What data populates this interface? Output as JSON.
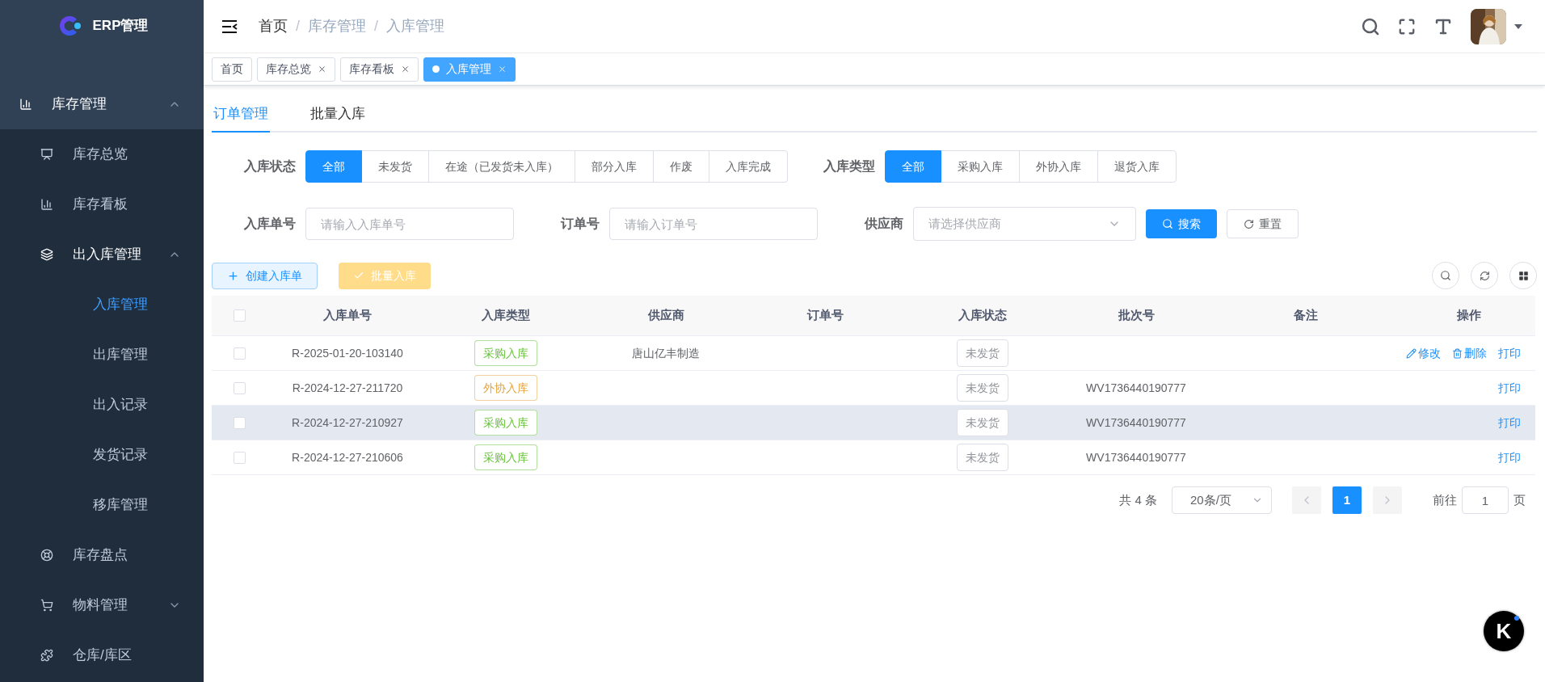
{
  "sidebar": {
    "title": "ERP管理",
    "items": [
      {
        "label": "库存管理",
        "expanded": true,
        "selected": false,
        "children": [
          {
            "label": "库存总览",
            "selected": false
          },
          {
            "label": "库存看板",
            "selected": false
          },
          {
            "label": "出入库管理",
            "expanded": true,
            "selected": false,
            "children": [
              {
                "label": "入库管理",
                "selected": true
              },
              {
                "label": "出库管理",
                "selected": false
              },
              {
                "label": "出入记录",
                "selected": false
              },
              {
                "label": "发货记录",
                "selected": false
              },
              {
                "label": "移库管理",
                "selected": false
              }
            ]
          },
          {
            "label": "库存盘点",
            "selected": false
          },
          {
            "label": "物料管理",
            "expanded": false,
            "selected": false
          },
          {
            "label": "仓库/库区",
            "selected": false
          }
        ]
      }
    ]
  },
  "breadcrumb": [
    "首页",
    "库存管理",
    "入库管理"
  ],
  "breadcrumb_separator": "/",
  "tags": [
    {
      "label": "首页",
      "closable": false,
      "selected": false
    },
    {
      "label": "库存总览",
      "closable": true,
      "selected": false
    },
    {
      "label": "库存看板",
      "closable": true,
      "selected": false
    },
    {
      "label": "入库管理",
      "closable": true,
      "selected": true
    }
  ],
  "tabs": [
    {
      "label": "订单管理",
      "selected": true
    },
    {
      "label": "批量入库",
      "selected": false
    }
  ],
  "filters": [
    {
      "label": "入库状态",
      "options": [
        {
          "label": "全部",
          "selected": true
        },
        {
          "label": "未发货",
          "selected": false
        },
        {
          "label": "在途（已发货未入库）",
          "selected": false
        },
        {
          "label": "部分入库",
          "selected": false
        },
        {
          "label": "作废",
          "selected": false
        },
        {
          "label": "入库完成",
          "selected": false
        }
      ]
    },
    {
      "label": "入库类型",
      "options": [
        {
          "label": "全部",
          "selected": true
        },
        {
          "label": "采购入库",
          "selected": false
        },
        {
          "label": "外协入库",
          "selected": false
        },
        {
          "label": "退货入库",
          "selected": false
        }
      ]
    }
  ],
  "search_fields": [
    {
      "label": "入库单号",
      "placeholder": "请输入入库单号",
      "kind": "input"
    },
    {
      "label": "订单号",
      "placeholder": "请输入订单号",
      "kind": "input"
    },
    {
      "label": "供应商",
      "placeholder": "请选择供应商",
      "kind": "select"
    }
  ],
  "search_button": "搜索",
  "reset_button": "重置",
  "create_button": "创建入库单",
  "batch_button": {
    "label": "批量入库",
    "disabled": true
  },
  "table": {
    "columns": [
      "入库单号",
      "入库类型",
      "供应商",
      "订单号",
      "入库状态",
      "批次号",
      "备注",
      "操作"
    ],
    "all_checked": false,
    "rows": [
      {
        "checked": false,
        "hovered": false,
        "number": "R-2025-01-20-103140",
        "type": {
          "label": "采购入库",
          "color": "#67c23a"
        },
        "supplier": "唐山亿丰制造",
        "status": "未发货",
        "actions": [
          {
            "label": "修改",
            "kind": "edit"
          },
          {
            "label": "删除",
            "kind": "delete"
          },
          {
            "label": "打印",
            "kind": "print"
          }
        ]
      },
      {
        "checked": false,
        "hovered": false,
        "number": "R-2024-12-27-211720",
        "type": {
          "label": "外协入库",
          "color": "#e6a23c"
        },
        "status": "未发货",
        "batch": "WV1736440190777",
        "actions": [
          {
            "label": "打印",
            "kind": "print"
          }
        ]
      },
      {
        "checked": false,
        "hovered": true,
        "number": "R-2024-12-27-210927",
        "type": {
          "label": "采购入库",
          "color": "#67c23a"
        },
        "status": "未发货",
        "batch": "WV1736440190777",
        "actions": [
          {
            "label": "打印",
            "kind": "print"
          }
        ]
      },
      {
        "checked": false,
        "hovered": false,
        "number": "R-2024-12-27-210606",
        "type": {
          "label": "采购入库",
          "color": "#67c23a"
        },
        "status": "未发货",
        "batch": "WV1736440190777",
        "actions": [
          {
            "label": "打印",
            "kind": "print"
          }
        ]
      }
    ]
  },
  "pagination": {
    "total": "共 4 条",
    "page_size": "20条/页",
    "pages": [
      {
        "label": "1",
        "selected": true
      }
    ],
    "goto_label": "前往",
    "goto_value": "1",
    "page_suffix": "页"
  },
  "floating_button": "K"
}
